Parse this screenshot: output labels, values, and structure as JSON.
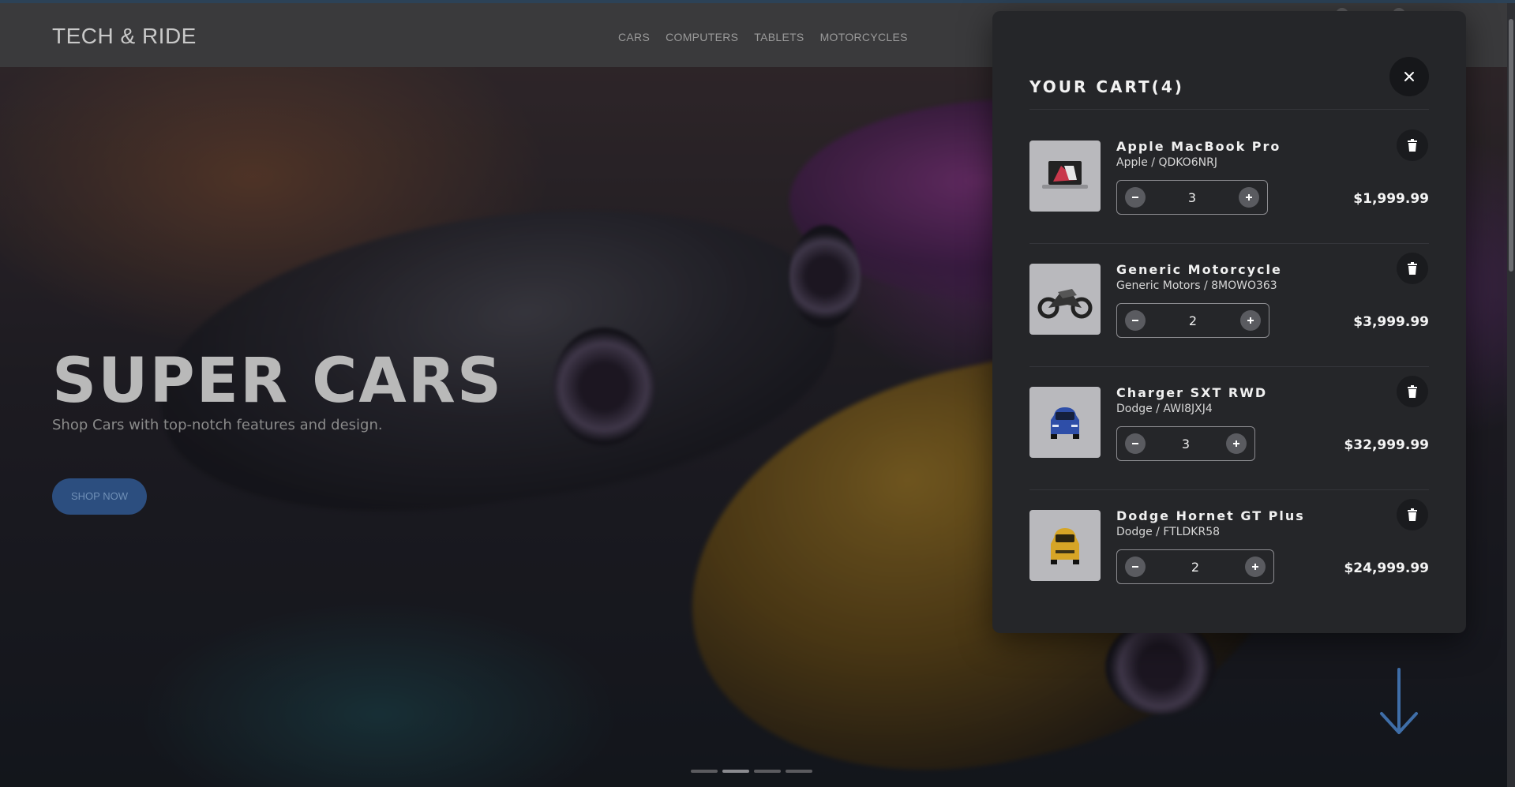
{
  "header": {
    "logo": "TECH & RIDE",
    "nav": [
      "CARS",
      "COMPUTERS",
      "TABLETS",
      "MOTORCYCLES"
    ]
  },
  "hero": {
    "title": "SUPER CARS",
    "subtitle": "Shop Cars with top-notch features and design.",
    "cta": "SHOP NOW"
  },
  "slider": {
    "slide_count": 4,
    "active_index": 1
  },
  "cart": {
    "title": "YOUR CART(4)",
    "items": [
      {
        "name": "Apple MacBook Pro",
        "meta": "Apple / QDKO6NRJ",
        "qty": "3",
        "price": "$1,999.99",
        "icon": "laptop-icon"
      },
      {
        "name": "Generic Motorcycle",
        "meta": "Generic Motors / 8MOWO363",
        "qty": "2",
        "price": "$3,999.99",
        "icon": "motorcycle-icon"
      },
      {
        "name": "Charger SXT RWD",
        "meta": "Dodge / AWI8JXJ4",
        "qty": "3",
        "price": "$32,999.99",
        "icon": "blue-car-icon"
      },
      {
        "name": "Dodge Hornet GT Plus",
        "meta": "Dodge / FTLDKR58",
        "qty": "2",
        "price": "$24,999.99",
        "icon": "yellow-car-icon"
      }
    ]
  },
  "colors": {
    "panel": "#252629",
    "accent": "#2c4e7f",
    "header": "#3a3a3c"
  }
}
